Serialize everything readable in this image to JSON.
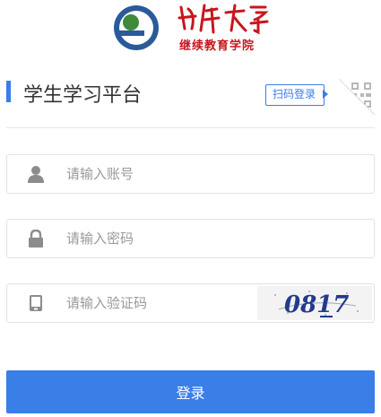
{
  "header": {
    "logo_calligraphy": "喀什大学",
    "subtitle": "继续教育学院"
  },
  "login": {
    "title": "学生学习平台",
    "qr_login_label": "扫码登录",
    "account_placeholder": "请输入账号",
    "password_placeholder": "请输入密码",
    "captcha_placeholder": "请输入验证码",
    "captcha_text": "0817",
    "submit_label": "登录"
  },
  "colors": {
    "accent": "#3a7ee8",
    "brand_red": "#c8161d",
    "icon_gray": "#8c8c8c"
  },
  "icons": [
    "user-icon",
    "lock-icon",
    "tablet-icon",
    "qr-code-icon"
  ]
}
